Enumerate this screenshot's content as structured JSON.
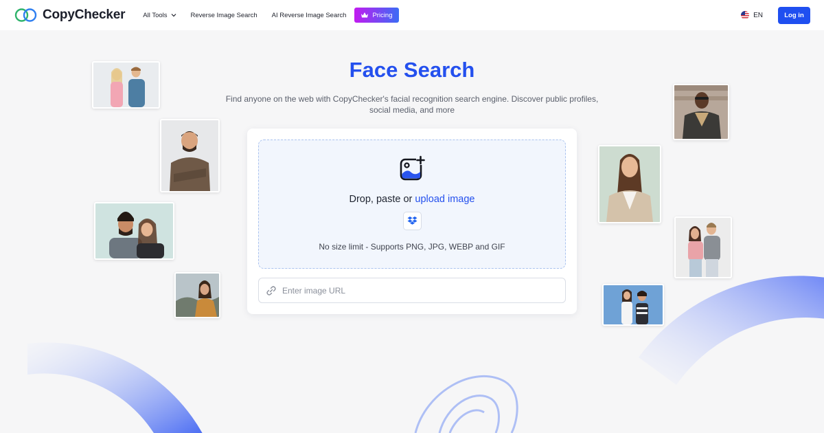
{
  "header": {
    "logo_text": "CopyChecker",
    "nav": [
      {
        "label": "All Tools"
      },
      {
        "label": "Reverse Image Search"
      },
      {
        "label": "AI Reverse Image Search"
      }
    ],
    "pricing_label": "Pricing",
    "language": "EN",
    "login_label": "Log in"
  },
  "hero": {
    "title": "Face Search",
    "subtitle": "Find anyone on the web with CopyChecker's facial recognition search engine. Discover public profiles, social media, and more"
  },
  "upload": {
    "drop_text": "Drop, paste or ",
    "upload_link": "upload image",
    "hint": "No size limit - Supports PNG, JPG, WEBP and GIF",
    "url_placeholder": "Enter image URL",
    "url_value": ""
  },
  "colors": {
    "accent": "#2450ee",
    "login": "#1f4ff0",
    "pricing_gradient_start": "#c21bf0",
    "pricing_gradient_end": "#3b6cf5"
  },
  "icons": {
    "logo": "interlocking-rings-icon",
    "nav_dropdown": "chevron-down-icon",
    "pricing": "crown-icon",
    "language": "us-flag-icon",
    "upload": "image-add-icon",
    "dropbox": "dropbox-icon",
    "url": "link-icon"
  }
}
